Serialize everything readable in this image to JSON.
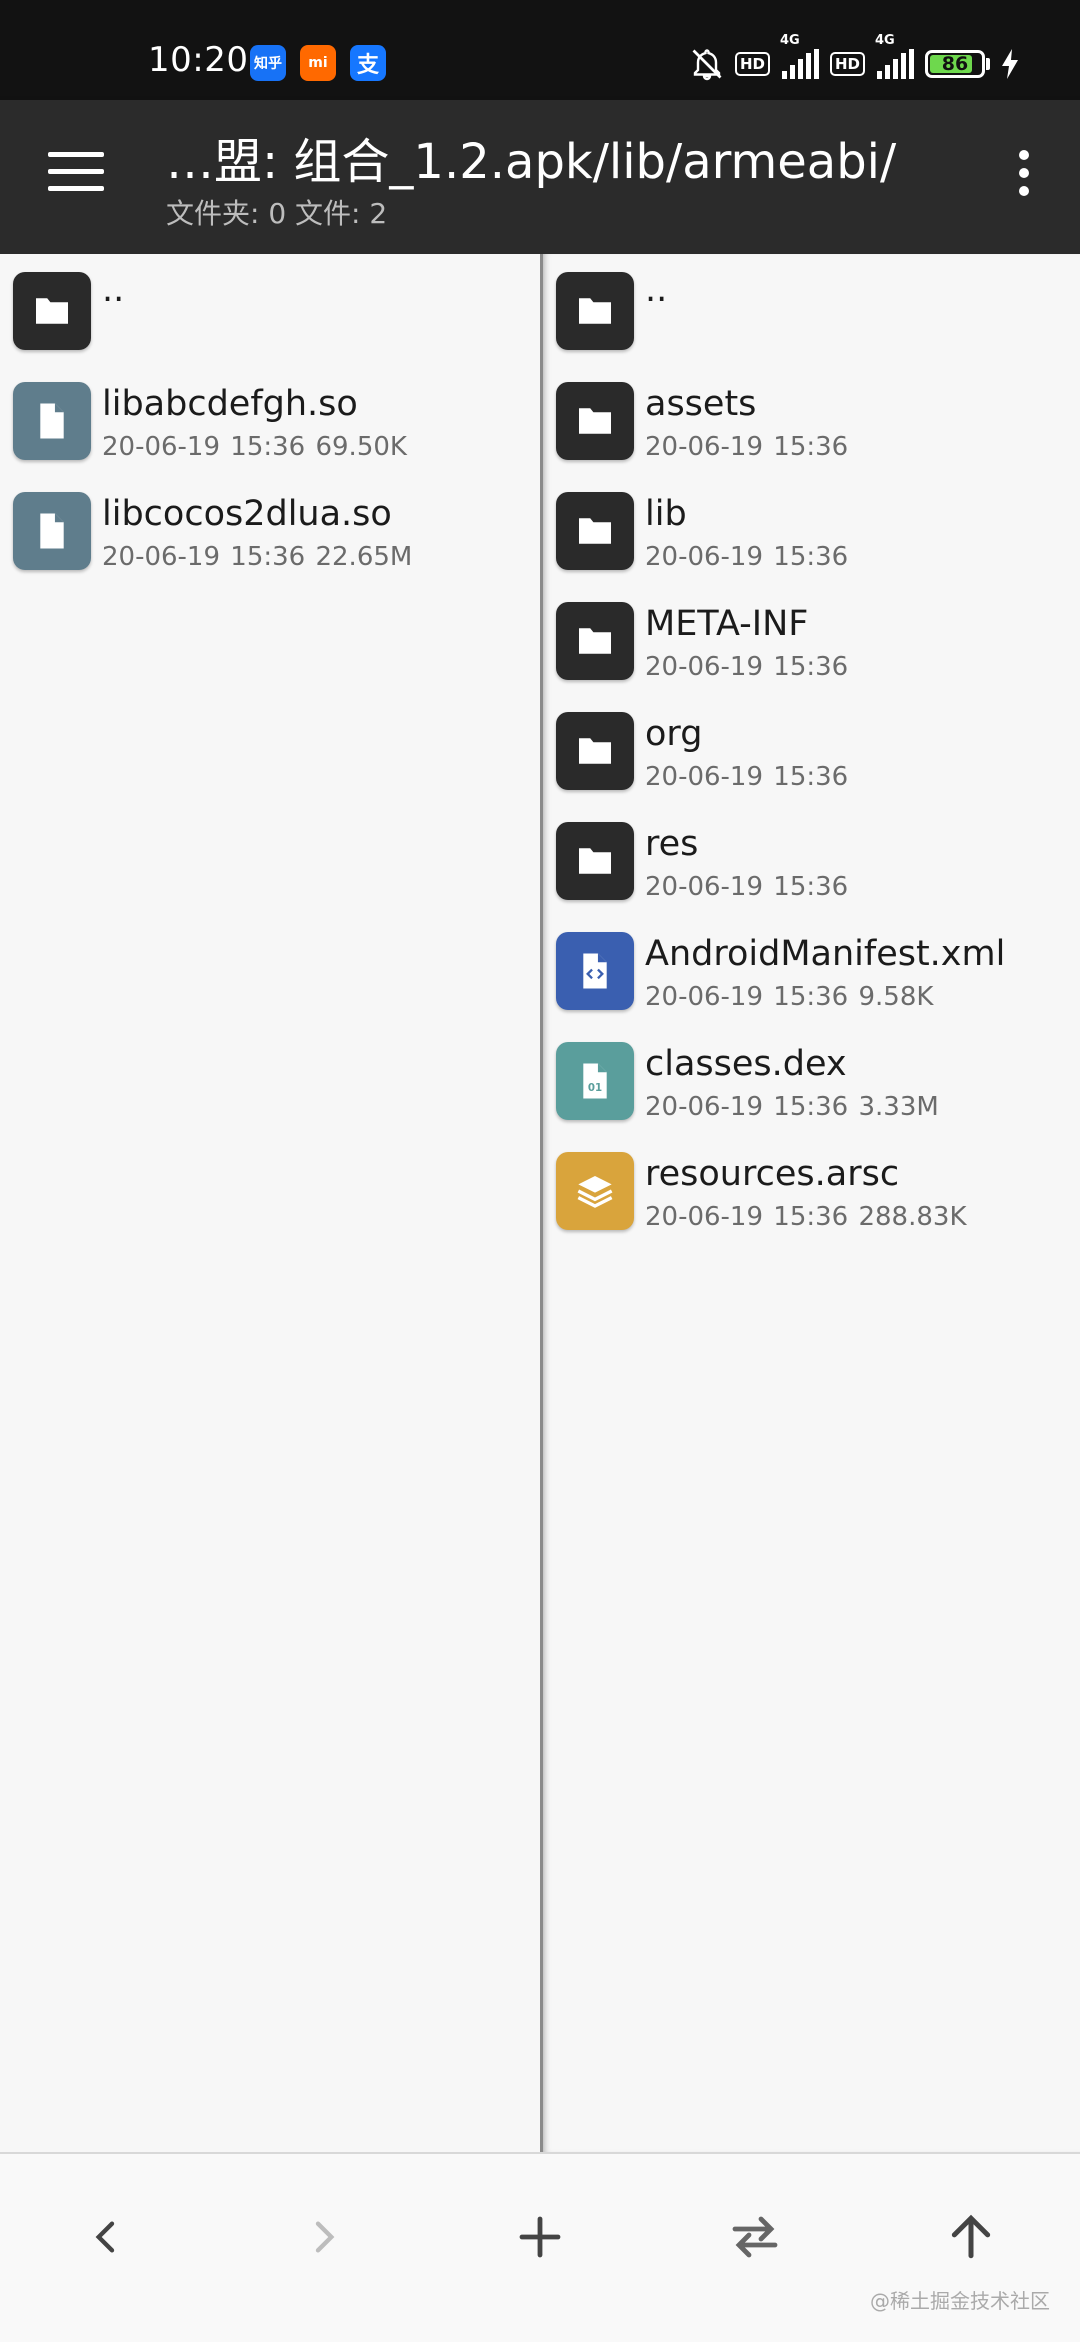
{
  "status_bar": {
    "time": "10:20",
    "apps": [
      {
        "icon": "zhihu-icon",
        "label": "知乎",
        "color": "#1772f6"
      },
      {
        "icon": "mi-icon",
        "label": "mi",
        "color": "#ff6900"
      },
      {
        "icon": "alipay-icon",
        "label": "支",
        "color": "#1677ff"
      }
    ],
    "hd_label": "HD",
    "network_label": "4G",
    "battery_level": "86",
    "battery_fraction": 0.86
  },
  "toolbar": {
    "title": "…盟: 组合_1.2.apk/lib/armeabi/",
    "subtitle": "文件夹: 0  文件: 2"
  },
  "left_pane": {
    "items": [
      {
        "name": "..",
        "meta": "",
        "icon": "folder-icon",
        "color": "#2a2a2a"
      },
      {
        "name": "libabcdefgh.so",
        "meta": "20-06-19 15:36  69.50K",
        "icon": "file-icon",
        "color": "#5f7d8c"
      },
      {
        "name": "libcocos2dlua.so",
        "meta": "20-06-19 15:36  22.65M",
        "icon": "file-icon",
        "color": "#5f7d8c"
      }
    ]
  },
  "right_pane": {
    "items": [
      {
        "name": "..",
        "meta": "",
        "icon": "folder-icon",
        "color": "#2a2a2a"
      },
      {
        "name": "assets",
        "meta": "20-06-19 15:36",
        "icon": "folder-icon",
        "color": "#2a2a2a"
      },
      {
        "name": "lib",
        "meta": "20-06-19 15:36",
        "icon": "folder-icon",
        "color": "#2a2a2a"
      },
      {
        "name": "META-INF",
        "meta": "20-06-19 15:36",
        "icon": "folder-icon",
        "color": "#2a2a2a"
      },
      {
        "name": "org",
        "meta": "20-06-19 15:36",
        "icon": "folder-icon",
        "color": "#2a2a2a"
      },
      {
        "name": "res",
        "meta": "20-06-19 15:36",
        "icon": "folder-icon",
        "color": "#2a2a2a"
      },
      {
        "name": "AndroidManifest.xml",
        "meta": "20-06-19 15:36  9.58K",
        "icon": "code-file-icon",
        "color": "#3a5fb0"
      },
      {
        "name": "classes.dex",
        "meta": "20-06-19 15:36  3.33M",
        "icon": "binary-file-icon",
        "color": "#5a9e9c"
      },
      {
        "name": "resources.arsc",
        "meta": "20-06-19 15:36  288.83K",
        "icon": "layers-icon",
        "color": "#d9a43c"
      }
    ]
  },
  "bottom_bar": {
    "buttons": [
      {
        "icon": "back-icon",
        "name": "back-button",
        "enabled": true
      },
      {
        "icon": "forward-icon",
        "name": "forward-button",
        "enabled": false
      },
      {
        "icon": "add-icon",
        "name": "add-button",
        "enabled": true
      },
      {
        "icon": "swap-icon",
        "name": "swap-panes-button",
        "enabled": true
      },
      {
        "icon": "up-arrow-icon",
        "name": "parent-dir-button",
        "enabled": true
      }
    ],
    "watermark": "@稀土掘金技术社区"
  }
}
